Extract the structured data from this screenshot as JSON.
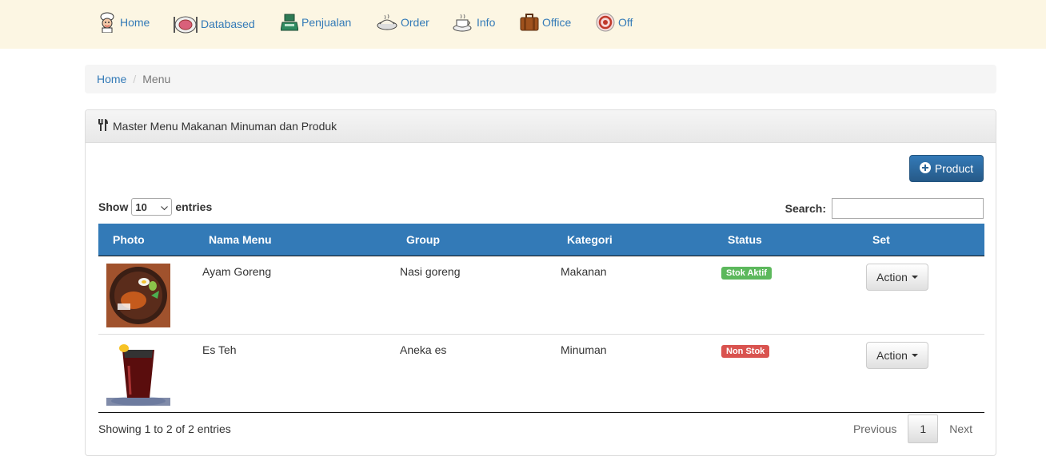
{
  "nav": {
    "items": [
      {
        "label": "Home",
        "icon": "chef-icon"
      },
      {
        "label": "Databased",
        "icon": "plate-icon"
      },
      {
        "label": "Penjualan",
        "icon": "cash-register-icon"
      },
      {
        "label": "Order",
        "icon": "food-tray-icon"
      },
      {
        "label": "Info",
        "icon": "coffee-cup-icon"
      },
      {
        "label": "Office",
        "icon": "briefcase-icon"
      },
      {
        "label": "Off",
        "icon": "power-icon"
      }
    ]
  },
  "breadcrumb": {
    "home": "Home",
    "separator": "/",
    "current": "Menu"
  },
  "panel": {
    "title": "Master Menu Makanan Minuman dan Produk",
    "title_icon": "cutlery-icon",
    "add_button": "Product"
  },
  "table_controls": {
    "show_label": "Show",
    "entries_value": "10",
    "entries_label": "entries",
    "search_label": "Search:",
    "search_value": ""
  },
  "table": {
    "columns": [
      "Photo",
      "Nama Menu",
      "Group",
      "Kategori",
      "Status",
      "Set"
    ],
    "rows": [
      {
        "photo": "fried-chicken-plate",
        "name": "Ayam Goreng",
        "group": "Nasi goreng",
        "kategori": "Makanan",
        "status": "Stok Aktif",
        "status_color": "#5cb85c",
        "action": "Action"
      },
      {
        "photo": "iced-tea-glass",
        "name": "Es Teh",
        "group": "Aneka es",
        "kategori": "Minuman",
        "status": "Non Stok",
        "status_color": "#d9534f",
        "action": "Action"
      }
    ]
  },
  "footer": {
    "info": "Showing 1 to 2 of 2 entries",
    "previous": "Previous",
    "page": "1",
    "next": "Next"
  },
  "colors": {
    "accent": "#337ab7",
    "nav_bg": "#fcf6e3"
  }
}
